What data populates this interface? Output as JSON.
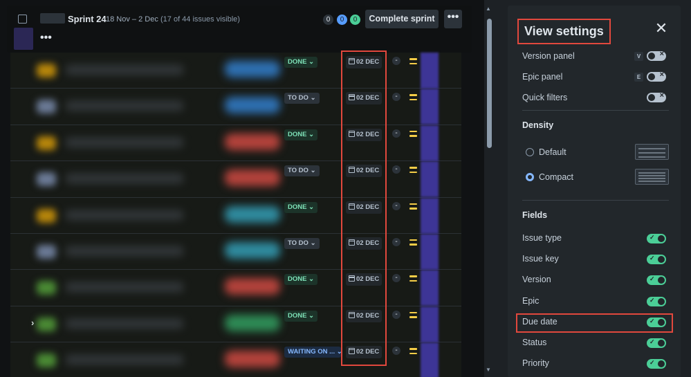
{
  "sprint": {
    "name": "Sprint 24",
    "dates": "18 Nov – 2 Dec",
    "visible_count": "(17 of 44 issues visible)",
    "count_todo": "0",
    "count_in_progress": "0",
    "count_done": "0",
    "complete_label": "Complete sprint",
    "more_label": "•••",
    "header_more_label": "•••"
  },
  "rows": [
    {
      "status": "DONE",
      "status_type": "done",
      "due": "02 DEC",
      "estimate": "-",
      "icon_color": "#b7860b",
      "tag_color": "#2e6fb0",
      "expand": ""
    },
    {
      "status": "TO DO",
      "status_type": "todo",
      "due": "02 DEC",
      "estimate": "-",
      "icon_color": "#6b7a96",
      "tag_color": "#2e6fb0",
      "expand": ""
    },
    {
      "status": "DONE",
      "status_type": "done",
      "due": "02 DEC",
      "estimate": "-",
      "icon_color": "#b7860b",
      "tag_color": "#b3423b",
      "expand": ""
    },
    {
      "status": "TO DO",
      "status_type": "todo",
      "due": "02 DEC",
      "estimate": "-",
      "icon_color": "#6b7a96",
      "tag_color": "#b3423b",
      "expand": ""
    },
    {
      "status": "DONE",
      "status_type": "done",
      "due": "02 DEC",
      "estimate": "-",
      "icon_color": "#b7860b",
      "tag_color": "#2f8a9e",
      "expand": ""
    },
    {
      "status": "TO DO",
      "status_type": "todo",
      "due": "02 DEC",
      "estimate": "-",
      "icon_color": "#6b7a96",
      "tag_color": "#2f8a9e",
      "expand": ""
    },
    {
      "status": "DONE",
      "status_type": "done",
      "due": "02 DEC",
      "estimate": "-",
      "icon_color": "#4a8a34",
      "tag_color": "#b3423b",
      "expand": ""
    },
    {
      "status": "DONE",
      "status_type": "done",
      "due": "02 DEC",
      "estimate": "-",
      "icon_color": "#4a8a34",
      "tag_color": "#2e8a55",
      "expand": "›"
    },
    {
      "status": "WAITING ON ...",
      "status_type": "waiting",
      "due": "02 DEC",
      "estimate": "-",
      "icon_color": "#4a8a34",
      "tag_color": "#b3423b",
      "expand": ""
    }
  ],
  "panel": {
    "title": "View settings",
    "close_label": "✕",
    "version_panel": "Version panel",
    "version_kbd": "V",
    "epic_panel": "Epic panel",
    "epic_kbd": "E",
    "quick_filters": "Quick filters",
    "density_heading": "Density",
    "density_default": "Default",
    "density_compact": "Compact",
    "fields_heading": "Fields",
    "fields": [
      {
        "label": "Issue type",
        "on": true
      },
      {
        "label": "Issue key",
        "on": true
      },
      {
        "label": "Version",
        "on": true
      },
      {
        "label": "Epic",
        "on": true
      },
      {
        "label": "Due date",
        "on": true
      },
      {
        "label": "Status",
        "on": true
      },
      {
        "label": "Priority",
        "on": true
      }
    ]
  },
  "colors": {
    "accent_purple": "#6e5dc6",
    "highlight_red": "#e2483d",
    "toggle_on": "#4bce97",
    "done_text": "#7ee2b8"
  }
}
